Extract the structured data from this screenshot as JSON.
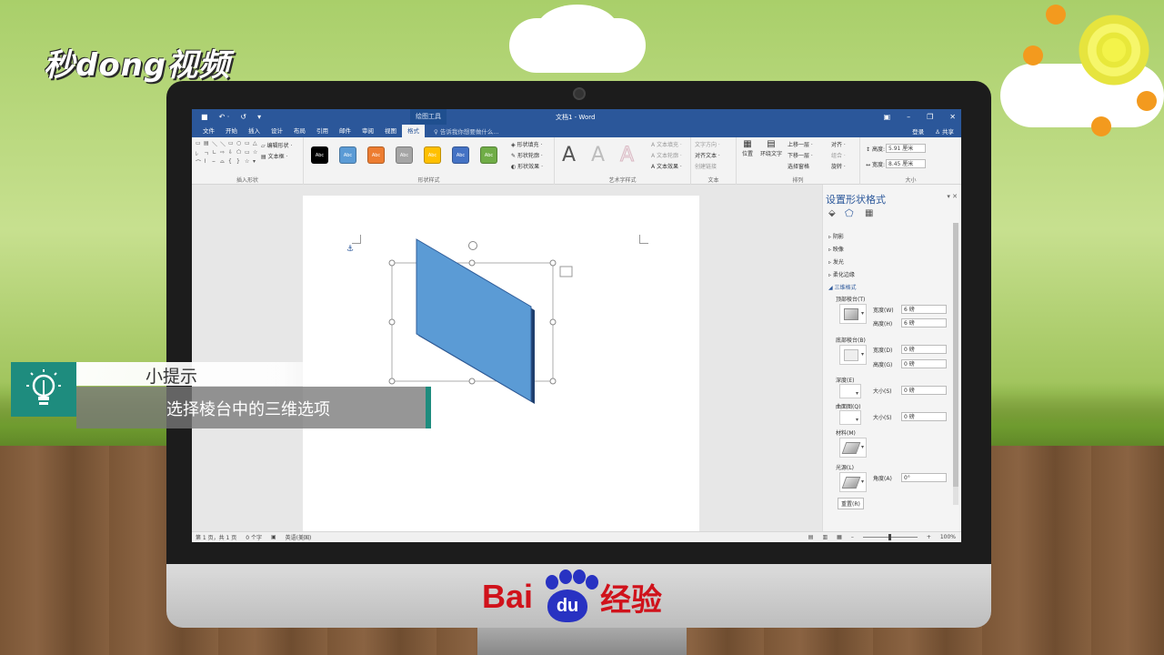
{
  "brand": {
    "logo_text": "秒dong视频",
    "baidu_text_left": "Bai",
    "baidu_text_paw": "du",
    "baidu_text_right": "经验"
  },
  "tip": {
    "title": "小提示",
    "body": "选择棱台中的三维选项"
  },
  "word": {
    "titlebar": {
      "context_tab": "绘图工具",
      "doc_title": "文档1 - Word",
      "undo": "↶ ·",
      "redo": "↺"
    },
    "tabs": [
      "文件",
      "开始",
      "插入",
      "设计",
      "布局",
      "引用",
      "邮件",
      "审阅",
      "视图",
      "格式"
    ],
    "active_tab": "格式",
    "tell_me": "告诉我你想要做什么...",
    "account": {
      "login": "登录",
      "share": "共享"
    },
    "ribbon": {
      "insert_shapes": {
        "label": "插入形状",
        "edit_shape": "编辑形状 ·",
        "text_box": "文本框 ·"
      },
      "shape_styles": {
        "label": "形状样式",
        "swatch_text": "Abc",
        "swatch_colors": [
          "#000000",
          "#5b9bd5",
          "#ed7d31",
          "#a5a5a5",
          "#ffc000",
          "#4472c4",
          "#70ad47"
        ],
        "fill": "形状填充 ·",
        "outline": "形状轮廓 ·",
        "effects": "形状效果 ·"
      },
      "wordart_styles": {
        "label": "艺术字样式",
        "letter": "A",
        "text_fill": "文本填充 ·",
        "text_outline": "文本轮廓 ·",
        "text_effects": "文本效果 ·"
      },
      "text": {
        "label": "文本",
        "direction": "文字方向 ·",
        "align": "对齐文本 ·",
        "link": "创建链接"
      },
      "arrange": {
        "label": "排列",
        "position": "位置",
        "wrap": "环绕文字",
        "forward": "上移一层 ·",
        "backward": "下移一层 ·",
        "select_pane": "选择窗格",
        "align": "对齐 ·",
        "group": "组合 ·",
        "rotate": "旋转 ·"
      },
      "size": {
        "label": "大小",
        "height_label": "高度:",
        "height_value": "5.91 厘米",
        "width_label": "宽度:",
        "width_value": "8.45 厘米"
      }
    },
    "pane": {
      "title": "设置形状格式",
      "sections": [
        "阴影",
        "映像",
        "发光",
        "柔化边缘",
        "三维格式"
      ],
      "top_bevel": "顶部棱台(T)",
      "bottom_bevel": "底部棱台(B)",
      "width_w": "宽度(W)",
      "height_h": "高度(H)",
      "width_d": "宽度(D)",
      "height_g": "高度(G)",
      "top_width_value": "6 磅",
      "top_height_value": "6 磅",
      "bottom_width_value": "0 磅",
      "bottom_height_value": "0 磅",
      "depth": "深度(E)",
      "depth_size_label": "大小(S)",
      "depth_value": "0 磅",
      "contour": "曲面图(Q)",
      "contour_size_label": "大小(S)",
      "contour_value": "0 磅",
      "material": "材料(M)",
      "lighting": "光源(L)",
      "angle_label": "角度(A)",
      "angle_value": "0°",
      "reset": "重置(R)"
    },
    "status": {
      "page": "第 1 页，共 1 页",
      "words": "0 个字",
      "lang": "英语(美国)",
      "zoom": "100%"
    }
  }
}
